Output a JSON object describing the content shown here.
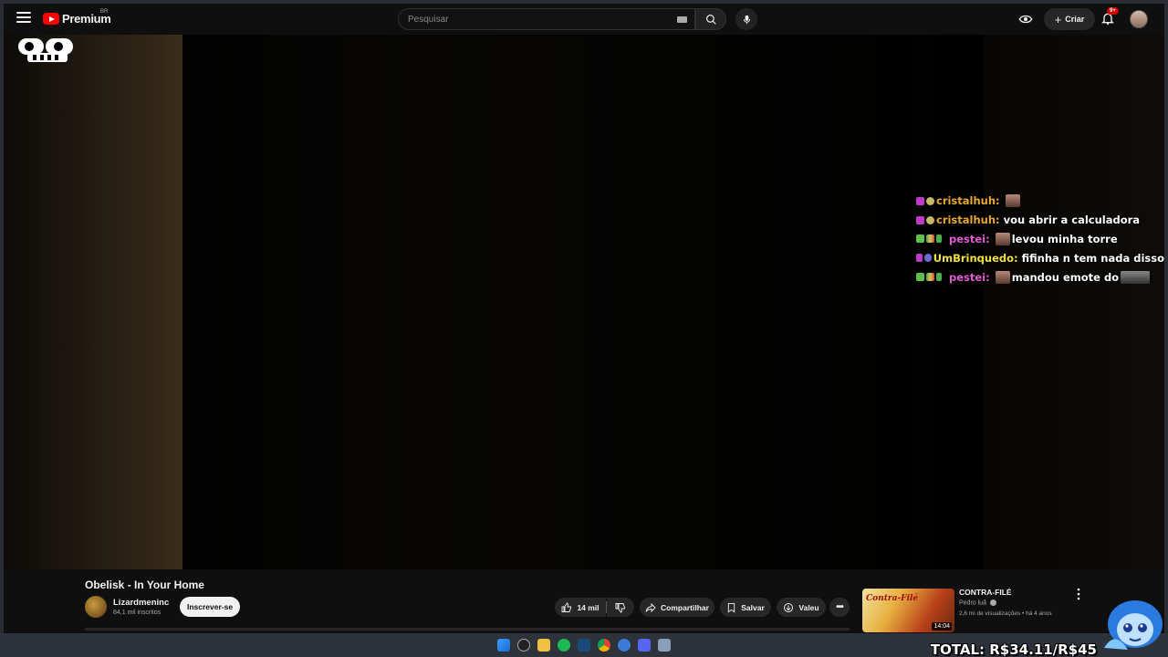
{
  "header": {
    "logo_text": "Premium",
    "logo_region": "BR",
    "search_placeholder": "Pesquisar",
    "create_label": "Criar",
    "notifications_badge": "9+"
  },
  "chat": {
    "messages": [
      {
        "user": "cristalhuh:",
        "user_color": "#e8a838",
        "text": "",
        "badges": [
          "heart",
          "gear"
        ],
        "emote": true
      },
      {
        "user": "cristalhuh:",
        "user_color": "#e8a838",
        "text": "vou abrir a calculadora",
        "badges": [
          "heart",
          "gear"
        ],
        "emote": false
      },
      {
        "user": "pestei:",
        "user_color": "#e05ad0",
        "text": "levou minha torre",
        "badges": [
          "green",
          "multi",
          "pencil"
        ],
        "emote": true
      },
      {
        "user": "UmBrinquedo:",
        "user_color": "#f0e040",
        "text": "fifinha n tem nada disso",
        "badges": [
          "heart",
          "game"
        ],
        "emote": false
      },
      {
        "user": "pestei:",
        "user_color": "#e05ad0",
        "text": "mandou emote do",
        "badges": [
          "green",
          "multi",
          "pencil"
        ],
        "emote": true,
        "trailing_emote": true
      }
    ]
  },
  "video": {
    "title": "Obelisk - In Your Home",
    "channel_name": "Lizardmeninc",
    "channel_subs": "84,1 mil inscritos",
    "subscribe_label": "Inscrever-se",
    "likes": "14 mil",
    "share_label": "Compartilhar",
    "save_label": "Salvar",
    "thanks_label": "Valeu"
  },
  "recommendation": {
    "title": "CONTRA-FILÉ",
    "channel": "Pedro luã",
    "meta": "2,6 mi de visualizações • há 4 anos",
    "duration": "14:04",
    "thumb_text": "Contra-Filé"
  },
  "overlay": {
    "total_text": "TOTAL: R$34.11/R$45"
  },
  "colors": {
    "accent_red": "#ff0000",
    "background": "#0f0f0f",
    "pill_bg": "#272727"
  }
}
